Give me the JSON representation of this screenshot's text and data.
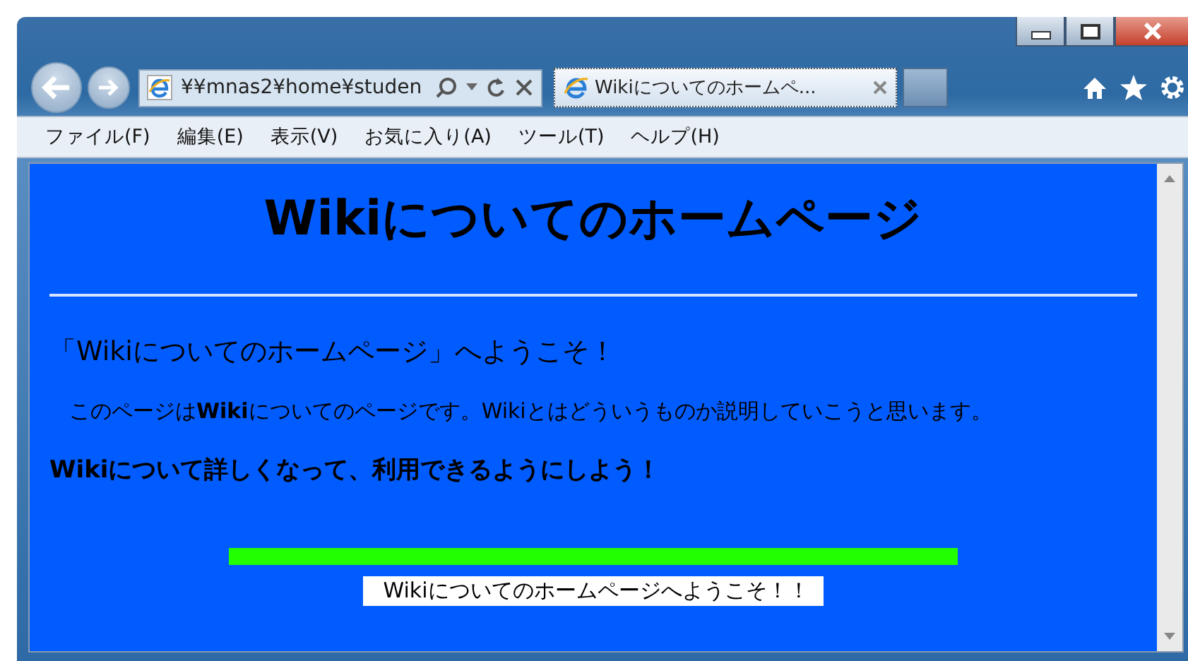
{
  "address_bar": {
    "value": "¥¥mnas2¥home¥studen"
  },
  "tabs": [
    {
      "label": "Wikiについてのホームペ...",
      "selected": true
    }
  ],
  "menu": [
    "ファイル(F)",
    "編集(E)",
    "表示(V)",
    "お気に入り(A)",
    "ツール(T)",
    "ヘルプ(H)"
  ],
  "page": {
    "heading": "Wikiについてのホームページ",
    "subheading": "「Wikiについてのホームページ」へようこそ！",
    "paragraph": "このページは**Wiki**についてのページです。Wikiとはどういうものか説明していこうと思います。",
    "bold_line": "Wikiについて詳しくなって、利用できるようにしよう！",
    "banner": "Wikiについてのホームページへようこそ！！"
  }
}
